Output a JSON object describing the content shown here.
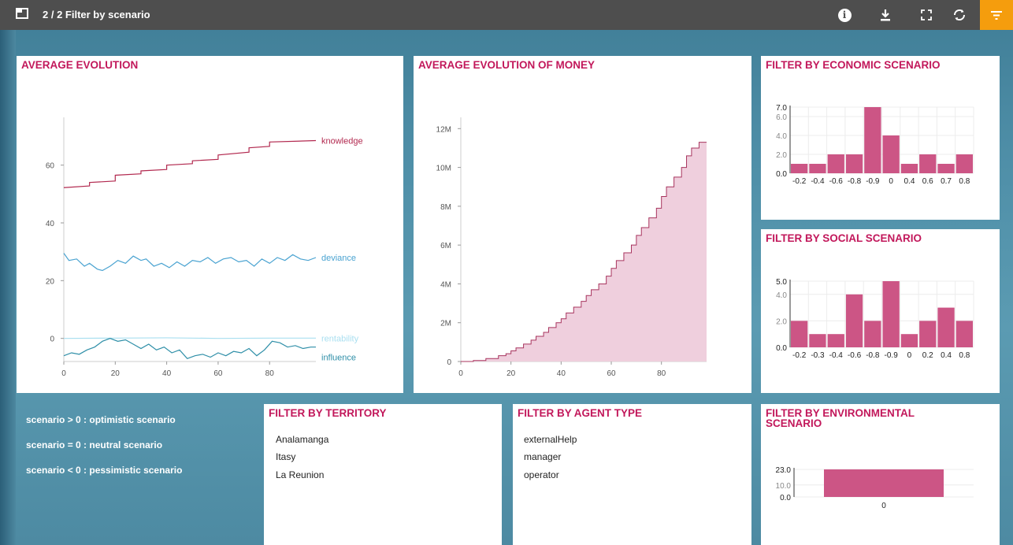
{
  "topbar": {
    "title": "2 / 2 Filter by scenario",
    "buttons": [
      "info-icon",
      "download-icon",
      "fullscreen-icon",
      "refresh-icon",
      "filter-icon"
    ]
  },
  "panels": {
    "avg_evolution": {
      "title": "AVERAGE EVOLUTION"
    },
    "avg_money": {
      "title": "AVERAGE EVOLUTION OF MONEY"
    },
    "economic": {
      "title": "FILTER BY ECONOMIC SCENARIO"
    },
    "social": {
      "title": "FILTER BY SOCIAL SCENARIO"
    },
    "territory": {
      "title": "FILTER BY TERRITORY",
      "items": [
        "Analamanga",
        "Itasy",
        "La Reunion"
      ]
    },
    "agent_type": {
      "title": "FILTER BY AGENT TYPE",
      "items": [
        "externalHelp",
        "manager",
        "operator"
      ]
    },
    "environmental": {
      "title_line1": "FILTER BY ENVIRONMENTAL",
      "title_line2": "SCENARIO"
    }
  },
  "legend": [
    "scenario > 0 : optimistic scenario",
    "scenario = 0 : neutral scenario",
    "scenario < 0 : pessimistic scenario"
  ],
  "colors": {
    "accent": "#c2185b",
    "bar": "#cc5585",
    "knowledge": "#b2294f",
    "deviance": "#4aa3d1",
    "rentability": "#a9dff0",
    "influence": "#2f8fa8",
    "area_fill": "#efcfdd",
    "area_line": "#a8345e",
    "topbar": "#4e4e4e",
    "filter_button": "#f59d0d"
  },
  "chart_data": [
    {
      "type": "line",
      "title": "AVERAGE EVOLUTION",
      "x_ticks": [
        0,
        20,
        40,
        60,
        80
      ],
      "y_ticks": [
        0,
        20,
        40,
        60
      ],
      "xlim": [
        0,
        98
      ],
      "ylim": [
        -8,
        76
      ],
      "series": [
        {
          "name": "knowledge",
          "x": [
            0,
            10,
            10,
            20,
            20,
            30,
            30,
            40,
            40,
            50,
            50,
            60,
            60,
            72,
            72,
            80,
            80,
            98
          ],
          "values": [
            52.2,
            52.8,
            54,
            54.5,
            56.5,
            57,
            58,
            58.5,
            60,
            60.5,
            61.5,
            62,
            63.5,
            64.5,
            66,
            66.5,
            68,
            68.5
          ]
        },
        {
          "name": "deviance",
          "x": [
            0,
            2,
            5,
            8,
            10,
            13,
            15,
            18,
            21,
            24,
            27,
            30,
            32,
            35,
            38,
            41,
            44,
            47,
            50,
            53,
            56,
            59,
            62,
            65,
            68,
            71,
            74,
            77,
            80,
            83,
            86,
            89,
            92,
            95,
            98
          ],
          "values": [
            29.5,
            27,
            27.5,
            25,
            26,
            24,
            23.5,
            25,
            27,
            26,
            28.5,
            27,
            27.5,
            25,
            26,
            24.5,
            26.5,
            25,
            27,
            26.5,
            28,
            26,
            27.5,
            28,
            26.5,
            27,
            25,
            27.5,
            26,
            28,
            27,
            29,
            27.5,
            27,
            28
          ]
        },
        {
          "name": "rentability",
          "x": [
            0,
            20,
            40,
            60,
            80,
            98
          ],
          "values": [
            0,
            0.1,
            0.2,
            0,
            0.1,
            0.1
          ]
        },
        {
          "name": "influence",
          "x": [
            0,
            3,
            6,
            9,
            12,
            15,
            18,
            21,
            24,
            27,
            30,
            33,
            36,
            39,
            42,
            45,
            48,
            51,
            54,
            57,
            60,
            63,
            66,
            69,
            72,
            75,
            78,
            81,
            84,
            87,
            90,
            93,
            96,
            98
          ],
          "values": [
            -6,
            -5,
            -5.5,
            -4,
            -3,
            -1,
            0,
            -1,
            -0.5,
            -2,
            -3.5,
            -2,
            -4,
            -3,
            -5,
            -4,
            -7,
            -6,
            -5.5,
            -6.5,
            -5,
            -6,
            -4.5,
            -5,
            -3.5,
            -6,
            -4,
            -1,
            -1.5,
            -3,
            -2.5,
            -3.5,
            -3,
            -3
          ]
        }
      ]
    },
    {
      "type": "area",
      "title": "AVERAGE EVOLUTION OF MONEY",
      "y_ticks": [
        "0",
        "2M",
        "4M",
        "6M",
        "8M",
        "10M",
        "12M"
      ],
      "y_tick_values": [
        0,
        2000000,
        4000000,
        6000000,
        8000000,
        10000000,
        12000000
      ],
      "x_ticks": [
        0,
        20,
        40,
        60,
        80
      ],
      "xlim": [
        0,
        98
      ],
      "ylim": [
        0,
        12500000
      ],
      "x": [
        0,
        5,
        10,
        15,
        18,
        20,
        22,
        25,
        28,
        30,
        33,
        35,
        38,
        40,
        42,
        45,
        48,
        50,
        52,
        55,
        58,
        60,
        62,
        65,
        68,
        70,
        72,
        75,
        78,
        80,
        82,
        85,
        88,
        90,
        92,
        95,
        98
      ],
      "values": [
        0,
        50000,
        150000,
        300000,
        400000,
        550000,
        700000,
        900000,
        1100000,
        1300000,
        1500000,
        1750000,
        2000000,
        2200000,
        2500000,
        2800000,
        3100000,
        3400000,
        3700000,
        4000000,
        4400000,
        4800000,
        5200000,
        5600000,
        6000000,
        6500000,
        6900000,
        7400000,
        7900000,
        8500000,
        9000000,
        9500000,
        10000000,
        10600000,
        11000000,
        11300000,
        11300000
      ]
    },
    {
      "type": "bar",
      "title": "FILTER BY ECONOMIC SCENARIO",
      "categories": [
        "-0.2",
        "-0.4",
        "-0.6",
        "-0.8",
        "-0.9",
        "0",
        "0.4",
        "0.6",
        "0.7",
        "0.8"
      ],
      "values": [
        1,
        1,
        2,
        2,
        7,
        4,
        1,
        2,
        1,
        2
      ],
      "y_ticks": [
        "0.0",
        "2.0",
        "4.0",
        "6.0",
        "7.0"
      ],
      "y_tick_values": [
        0,
        2,
        4,
        6,
        7
      ],
      "ylim": [
        0,
        7
      ]
    },
    {
      "type": "bar",
      "title": "FILTER BY SOCIAL SCENARIO",
      "categories": [
        "-0.2",
        "-0.3",
        "-0.4",
        "-0.6",
        "-0.8",
        "-0.9",
        "0",
        "0.2",
        "0.4",
        "0.8"
      ],
      "values": [
        2,
        1,
        1,
        4,
        2,
        5,
        1,
        2,
        3,
        2
      ],
      "y_ticks": [
        "0.0",
        "2.0",
        "4.0",
        "5.0"
      ],
      "y_tick_values": [
        0,
        2,
        4,
        5
      ],
      "ylim": [
        0,
        5
      ]
    },
    {
      "type": "bar",
      "title": "FILTER BY ENVIRONMENTAL SCENARIO",
      "categories": [
        "0"
      ],
      "values": [
        23
      ],
      "y_ticks": [
        "0.0",
        "10.0",
        "23.0"
      ],
      "y_tick_values": [
        0,
        10,
        23
      ],
      "ylim": [
        0,
        23
      ]
    }
  ]
}
